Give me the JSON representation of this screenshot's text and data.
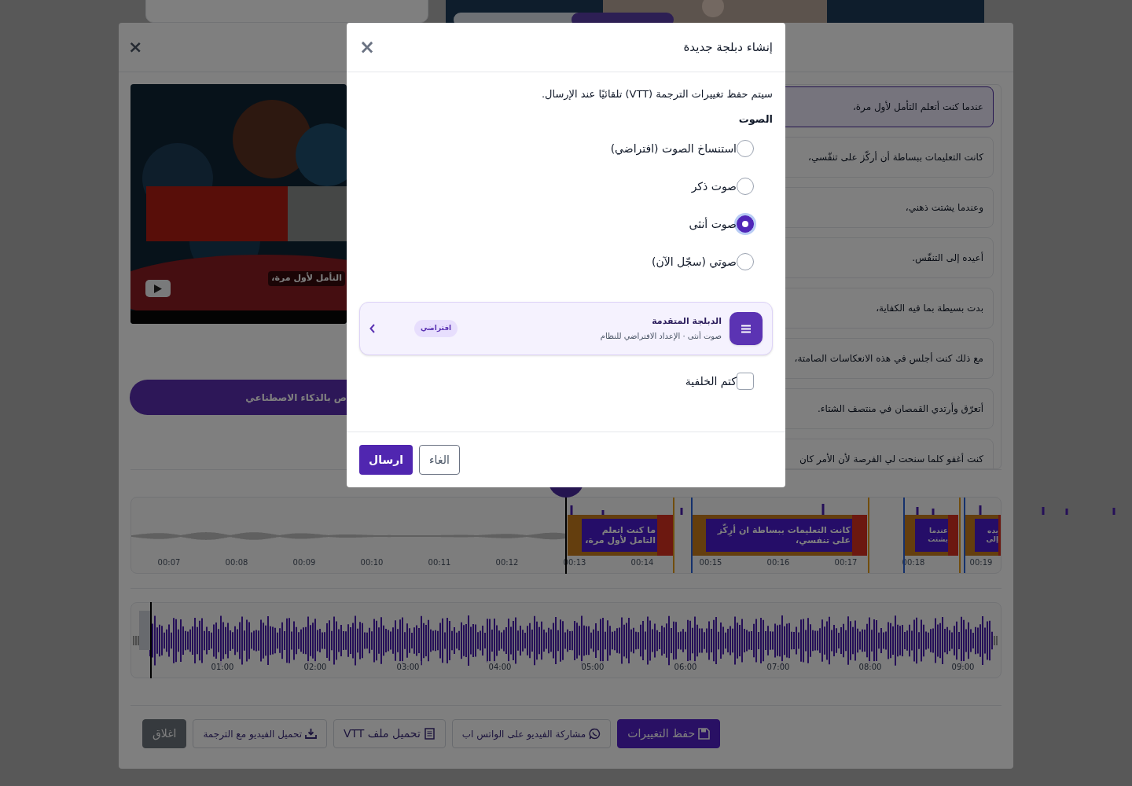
{
  "editor": {
    "close": "×",
    "video": {
      "kind": "picture",
      "caption": "التأمل لأول مرة،"
    },
    "ai_button": "ص بالذكاء الاصطناعي",
    "segments": [
      {
        "text": "عندما كنت أتعلم التأمل لأول مرة،",
        "selected": true
      },
      {
        "text": "كانت التعليمات ببساطة أن أركّز على تنفّسي،",
        "selected": false
      },
      {
        "text": "وعندما يشتت ذهني،",
        "selected": false
      },
      {
        "text": "أعيده إلى التنفّس.",
        "selected": false
      },
      {
        "text": "بدت بسيطة بما فيه الكفاية،",
        "selected": false
      },
      {
        "text": "مع ذلك كنت أجلس في هذه الانعكاسات الصامتة،",
        "selected": false
      },
      {
        "text": "أتعرّق وأرتدي القمصان في منتصف الشتاء.",
        "selected": false
      },
      {
        "text": "كنت أغفو كلما سنحت لي الفرصة لأن الأمر كان",
        "selected": false
      }
    ],
    "timeline": {
      "ticks": [
        "00:19",
        "00:18",
        "00:17",
        "00:16",
        "00:15",
        "00:14",
        "00:13",
        "00:12",
        "00:11",
        "00:10",
        "00:09",
        "00:08",
        "00:07"
      ],
      "clips": [
        {
          "text": "يده إلى"
        },
        {
          "text": "عندما يشتت"
        },
        {
          "text": "كانت التعليمات ببساطة ان أرِكّز على تنفسي،"
        },
        {
          "text": "ما كنت اتعلم التامل لأول مرة،"
        }
      ]
    },
    "overview": {
      "ticks": [
        "09:00",
        "08:00",
        "07:00",
        "06:00",
        "05:00",
        "04:00",
        "03:00",
        "02:00",
        "01:00"
      ]
    },
    "footer_buttons": [
      {
        "label": "حفظ التغييرات",
        "kind": "save"
      },
      {
        "label": "مشاركة الفيديو على الواتس اب",
        "kind": "share"
      },
      {
        "label": "تحميل ملف VTT",
        "kind": "vtt"
      },
      {
        "label": "تحميل الفيديو مع الترجمة",
        "kind": "download"
      },
      {
        "label": "اغلاق",
        "kind": "close"
      }
    ]
  },
  "dialog": {
    "title": "إنشاء دبلجة جديدة",
    "close": "×",
    "note": "سيتم حفظ تغييرات الترجمة (VTT) تلقائيًا عند الإرسال.",
    "voice_heading": "الصوت",
    "voice_options": [
      {
        "label": "استنساخ الصوت (افتراضي)",
        "selected": false
      },
      {
        "label": "صوت ذكر",
        "selected": false
      },
      {
        "label": "صوت أنثى",
        "selected": true
      },
      {
        "label": "صوتي (سجّل الآن)",
        "selected": false
      }
    ],
    "advanced": {
      "title": "الدبلجة المتقدمة",
      "subtitle": "صوت أنثى · الإعداد الافتراضي للنظام",
      "badge": "افتراضي"
    },
    "mute_background": {
      "label": "كتم الخلفية",
      "checked": false
    },
    "buttons": [
      {
        "label": "الغاء",
        "kind": "cancel"
      },
      {
        "label": "ارسال",
        "kind": "submit"
      }
    ]
  }
}
